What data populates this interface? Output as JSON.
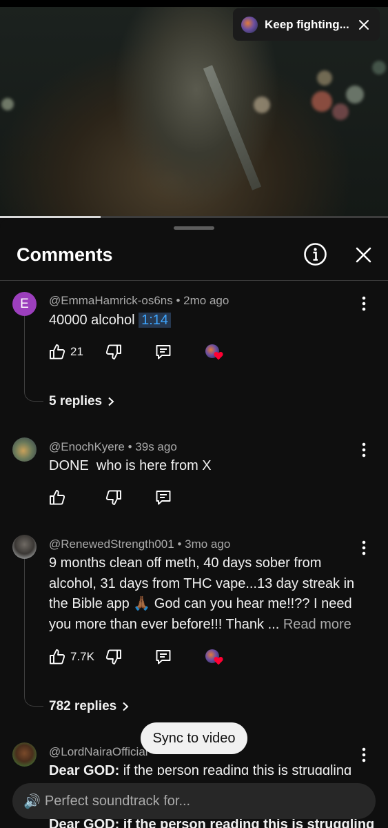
{
  "video": {
    "miniplayer_chip": {
      "title": "Keep fighting...",
      "close_icon": "close-icon"
    },
    "progress_fraction": 0.26
  },
  "panel": {
    "title": "Comments",
    "info_icon": "info-circle-icon",
    "close_icon": "close-icon"
  },
  "comments": [
    {
      "author": "@EmmaHamrick-os6ns",
      "age": "2mo ago",
      "avatar_letter": "E",
      "text_prefix": "40000 alcohol ",
      "timestamp_link": "1:14",
      "likes": "21",
      "creator_hearted": true,
      "replies": "5 replies"
    },
    {
      "author": "@EnochKyere",
      "age": "39s ago",
      "text": "DONE  who is here from X",
      "likes": ""
    },
    {
      "author": "@RenewedStrength001",
      "age": "3mo ago",
      "text": "9 months clean off meth, 40 days sober from alcohol, 31 days from THC vape...13 day streak in the Bible app 🙏🏾 God can you hear me!!?? I need you more than ever before!!! Thank ... ",
      "read_more": "Read more",
      "likes": "7.7K",
      "creator_hearted": true,
      "replies": "782 replies"
    },
    {
      "author": "@LordNairaOfficial",
      "age": "",
      "text_bold_prefix": "Dear GOD:",
      "text": " if the person reading this is struggling"
    }
  ],
  "sync_button": "Sync to video",
  "composer": {
    "placeholder": "Perfect soundtrack for...",
    "icon": "speaker-icon"
  },
  "behind_composer_text": "Dear GOD: if the person reading this is struggling",
  "colors": {
    "background": "#0f0f0f",
    "timestamp_link": "#3ea6ff",
    "timestamp_bg": "#263850",
    "avatar_e": "#9c3fbd",
    "heart": "#ff0033"
  }
}
